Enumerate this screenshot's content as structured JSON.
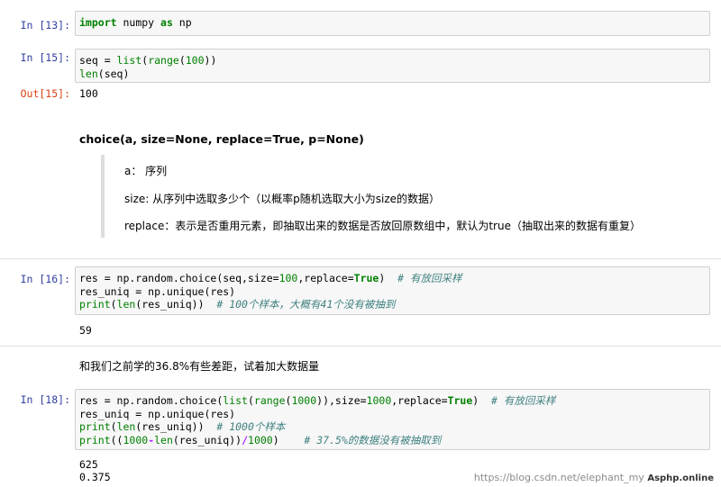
{
  "cells": {
    "c13": {
      "prompt": "In  [13]:"
    },
    "c15": {
      "prompt": "In  [15]:",
      "out_prompt": "Out[15]:",
      "output": "100"
    },
    "c16": {
      "prompt": "In  [16]:",
      "output": "59"
    },
    "c18": {
      "prompt": "In  [18]:",
      "output_line1": "625",
      "output_line2": "0.375"
    }
  },
  "code": {
    "t_import": "import",
    "t_numpy": " numpy ",
    "t_as": "as",
    "t_np": " np",
    "t_seq": "seq = ",
    "t_list": "list",
    "t_lparen": "(",
    "t_range": "range",
    "t_lparen2": "(",
    "t_100": "100",
    "t_rparen2": "))",
    "t_len": "len",
    "t_lenseq": "(seq)",
    "t_res": "res = np.random.choice(seq,size=",
    "t_100b": "100",
    "t_replace": ",replace=",
    "t_true": "True",
    "t_rp": ")  ",
    "t_com1": "# 有放回采样",
    "t_resuniq": "res_uniq = np.unique(res)",
    "t_print": "print",
    "t_p1": "(",
    "t_len2": "len",
    "t_p2": "(res_uniq))  ",
    "t_com2": "# 100个样本，大概有41个没有被抽到",
    "t18_res": "res = np.random.choice(",
    "t18_list": "list",
    "t18_p": "(",
    "t18_range": "range",
    "t18_p2": "(",
    "t18_1000": "1000",
    "t18_p3": ")),size=",
    "t18_1000b": "1000",
    "t18_rep": ",replace=",
    "t18_true": "True",
    "t18_rp": ")  ",
    "t18_com1": "# 有放回采样",
    "t18_uniq": "res_uniq = np.unique(res)",
    "t18_print": "print",
    "t18_pp": "(",
    "t18_len": "len",
    "t18_pp2": "(res_uniq))  ",
    "t18_com2": "# 1000个样本",
    "t18_print2": "print",
    "t18_q1": "((",
    "t18_1000c": "1000",
    "t18_minus": "-",
    "t18_len2": "len",
    "t18_q2": "(res_uniq))",
    "t18_div": "/",
    "t18_1000d": "1000",
    "t18_q3": ")    ",
    "t18_com3": "# 37.5%的数据没有被抽取到"
  },
  "markdown": {
    "title": "choice(a, size=None, replace=True, p=None)",
    "a_desc": "a：  序列",
    "size_desc": "size: 从序列中选取多少个（以概率p随机选取大小为size的数据）",
    "replace_desc": "replace：表示是否重用元素，即抽取出来的数据是否放回原数组中，默认为true（抽取出来的数据有重复）",
    "note": "和我们之前学的36.8%有些差距，试着加大数据量"
  },
  "watermark": {
    "text": "https://blog.csdn.net/elephant_my",
    "site": "Asphp.online"
  }
}
